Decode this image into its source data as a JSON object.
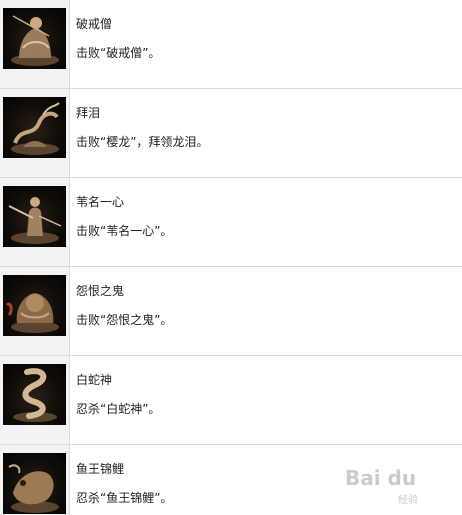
{
  "achievements": [
    {
      "title": "破戒僧",
      "desc": "击败“破戒僧”。",
      "icon": "monk-statue-icon"
    },
    {
      "title": "拜泪",
      "desc": "击败“樱龙”，拜领龙泪。",
      "icon": "dragon-statue-icon"
    },
    {
      "title": "苇名一心",
      "desc": "击败“苇名一心”。",
      "icon": "swordsman-statue-icon"
    },
    {
      "title": "怨恨之鬼",
      "desc": "击败“怨恨之鬼”。",
      "icon": "demon-statue-icon"
    },
    {
      "title": "白蛇神",
      "desc": "忍杀“白蛇神”。",
      "icon": "serpent-statue-icon"
    },
    {
      "title": "鱼王锦鲤",
      "desc": "忍杀“鱼王锦鲤”。",
      "icon": "carp-statue-icon"
    }
  ],
  "watermark": {
    "logo": "Bai du",
    "sub": "经验"
  },
  "colors": {
    "icon_bg": "#f3f3f3",
    "statue": "#b89a78",
    "divider": "#d8d8d8"
  }
}
